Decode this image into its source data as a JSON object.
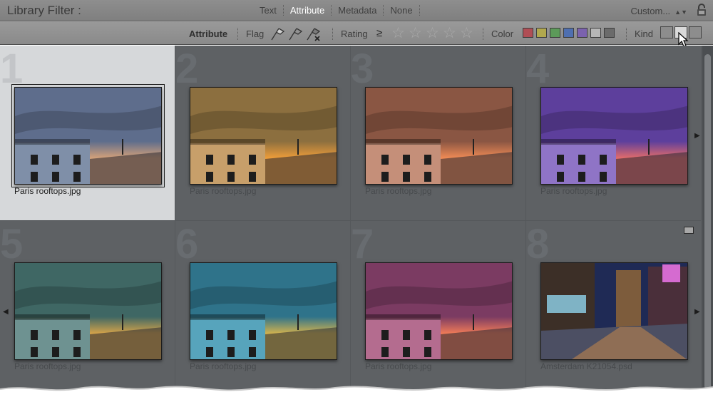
{
  "filter_bar": {
    "title": "Library Filter :",
    "modes": [
      "Text",
      "Attribute",
      "Metadata",
      "None"
    ],
    "active_mode": "Attribute",
    "preset": "Custom..."
  },
  "attribute_bar": {
    "label": "Attribute",
    "flag_label": "Flag",
    "rating_label": "Rating",
    "rating_operator": "≥",
    "stars": [
      "☆",
      "☆",
      "☆",
      "☆",
      "☆"
    ],
    "color_label": "Color",
    "colors": [
      "#b04e55",
      "#b1a84d",
      "#5c9a59",
      "#4f6fb0",
      "#7b62ae",
      "#b7b7b7",
      "#6b6b6b"
    ],
    "kind_label": "Kind",
    "kind_options": [
      "master-photos",
      "virtual-copies",
      "videos"
    ],
    "active_kind": "virtual-copies"
  },
  "grid": {
    "cells": [
      {
        "number": "1",
        "filename": "Paris rooftops.jpg",
        "tint": [
          "#5e6d8c",
          "#d2a07a",
          "#7f8fa8"
        ],
        "selected": true
      },
      {
        "number": "2",
        "filename": "Paris rooftops.jpg",
        "tint": [
          "#8c6f3f",
          "#ec9c3a",
          "#c79f6a"
        ],
        "selected": false
      },
      {
        "number": "3",
        "filename": "Paris rooftops.jpg",
        "tint": [
          "#8a5643",
          "#ee8a55",
          "#c58f79"
        ],
        "selected": false
      },
      {
        "number": "4",
        "filename": "Paris rooftops.jpg",
        "tint": [
          "#5d3f9c",
          "#e06b6b",
          "#8f74c6"
        ],
        "selected": false
      },
      {
        "number": "5",
        "filename": "Paris rooftops.jpg",
        "tint": [
          "#3f6764",
          "#d2a24a",
          "#6e9291"
        ],
        "selected": false
      },
      {
        "number": "6",
        "filename": "Paris rooftops.jpg",
        "tint": [
          "#2f738a",
          "#cfb14f",
          "#57a4bc"
        ],
        "selected": false
      },
      {
        "number": "7",
        "filename": "Paris rooftops.jpg",
        "tint": [
          "#7b3b62",
          "#ee7a58",
          "#b46c8f"
        ],
        "selected": false
      },
      {
        "number": "8",
        "filename": "Amsterdam K21054.psd",
        "tint": [
          "#1f2a55",
          "#c7894a",
          "#4c4f63"
        ],
        "selected": false,
        "night": true
      }
    ]
  }
}
